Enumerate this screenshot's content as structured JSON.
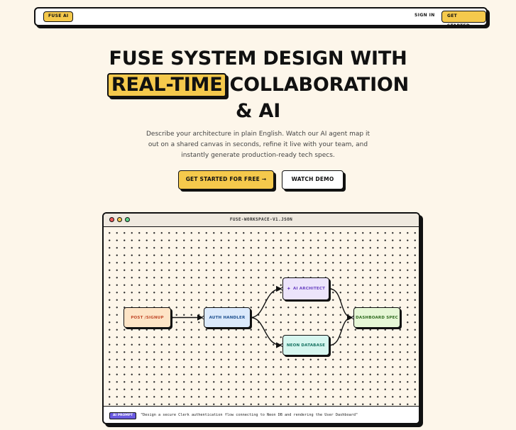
{
  "nav": {
    "brand": "FUSE AI",
    "sign_in": "SIGN IN",
    "cta": "GET STARTED"
  },
  "hero": {
    "line1": "FUSE SYSTEM DESIGN WITH",
    "highlight": "REAL-TIME",
    "line2_rest": "COLLABORATION",
    "line3": "& AI",
    "subtitle": "Describe your architecture in plain English. Watch our AI agent map it out on a shared canvas in seconds, refine it live with your team, and instantly generate production-ready tech specs.",
    "primary_button": "GET STARTED FOR FREE →",
    "secondary_button": "WATCH DEMO"
  },
  "workspace": {
    "title": "FUSE-WORKSPACE-V1.JSON",
    "nodes": {
      "post": "POST /SIGNUP",
      "auth": "AUTH HANDLER",
      "ai": "AI ARCHITECT",
      "neon": "NEON DATABASE",
      "dashboard": "DASHBOARD SPEC"
    },
    "prompt_badge": "AI PROMPT",
    "prompt_text": "\"Design a secure Clerk authentication flow connecting to Neon DB and rendering the User Dashboard\""
  },
  "colors": {
    "background": "#fdf6ea",
    "accent": "#f5c94c",
    "ink": "#111111",
    "ai_badge": "#6a5ae0"
  }
}
